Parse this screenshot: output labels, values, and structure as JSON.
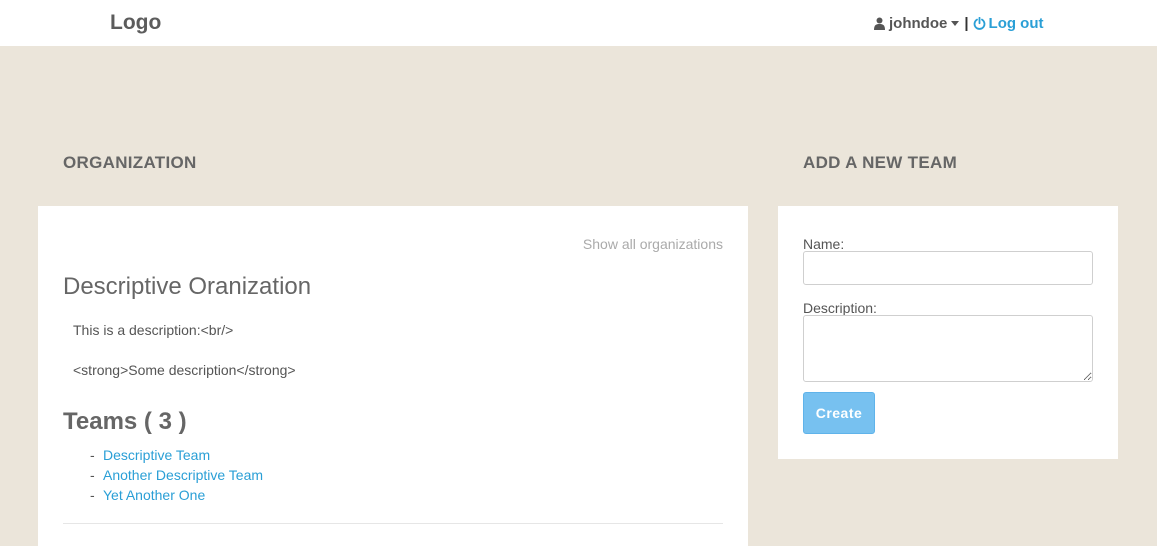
{
  "header": {
    "logo": "Logo",
    "username": "johndoe",
    "separator": "|",
    "logout_label": "Log out",
    "icons": {
      "user": "user-icon",
      "dropdown": "caret-down-icon",
      "logout": "power-icon"
    }
  },
  "organization": {
    "section_title": "ORGANIZATION",
    "show_all_link": "Show all organizations",
    "name": "Descriptive Oranization",
    "description": "This is a description:<br/>\n\n<strong>Some description</strong>",
    "teams_heading": "Teams ( 3 )",
    "teams": [
      {
        "bullet": "-",
        "name": "Descriptive Team"
      },
      {
        "bullet": "-",
        "name": "Another Descriptive Team"
      },
      {
        "bullet": "-",
        "name": "Yet Another One"
      }
    ]
  },
  "new_team": {
    "section_title": "ADD A NEW TEAM",
    "name_label": "Name:",
    "name_value": "",
    "description_label": "Description:",
    "description_value": "",
    "create_button": "Create"
  },
  "colors": {
    "page_background": "#ebe5da",
    "link": "#2a9fd6",
    "button": "#77c1f0"
  }
}
